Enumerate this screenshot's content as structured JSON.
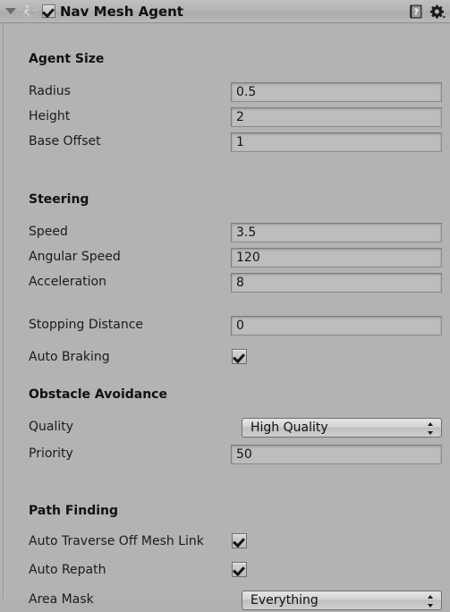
{
  "component": {
    "title": "Nav Mesh Agent",
    "enabled": true,
    "expanded": true,
    "icon": "nav-mesh-agent-icon",
    "help_icon": "help-book-icon",
    "settings_icon": "gear-icon",
    "foldout_icon": "triangle-down-icon"
  },
  "sections": [
    {
      "title": "Agent Size",
      "rows": [
        {
          "label": "Radius",
          "type": "number",
          "value": "0.5"
        },
        {
          "label": "Height",
          "type": "number",
          "value": "2"
        },
        {
          "label": "Base Offset",
          "type": "number",
          "value": "1"
        }
      ]
    },
    {
      "title": "Steering",
      "rows": [
        {
          "label": "Speed",
          "type": "number",
          "value": "3.5"
        },
        {
          "label": "Angular Speed",
          "type": "number",
          "value": "120"
        },
        {
          "label": "Acceleration",
          "type": "number",
          "value": "8"
        },
        {
          "label": "Stopping Distance",
          "type": "number",
          "value": "0"
        },
        {
          "label": "Auto Braking",
          "type": "checkbox",
          "value": true
        }
      ]
    },
    {
      "title": "Obstacle Avoidance",
      "rows": [
        {
          "label": "Quality",
          "type": "popup",
          "value": "High Quality"
        },
        {
          "label": "Priority",
          "type": "number",
          "value": "50"
        }
      ]
    },
    {
      "title": "Path Finding",
      "rows": [
        {
          "label": "Auto Traverse Off Mesh Link",
          "type": "checkbox",
          "value": true
        },
        {
          "label": "Auto Repath",
          "type": "checkbox",
          "value": true
        },
        {
          "label": "Area Mask",
          "type": "popup",
          "value": "Everything"
        }
      ]
    }
  ],
  "colors": {
    "background": "#b3b3b3",
    "header": "#b8b8b8",
    "field": "#bdbdbd",
    "text": "#141414"
  }
}
